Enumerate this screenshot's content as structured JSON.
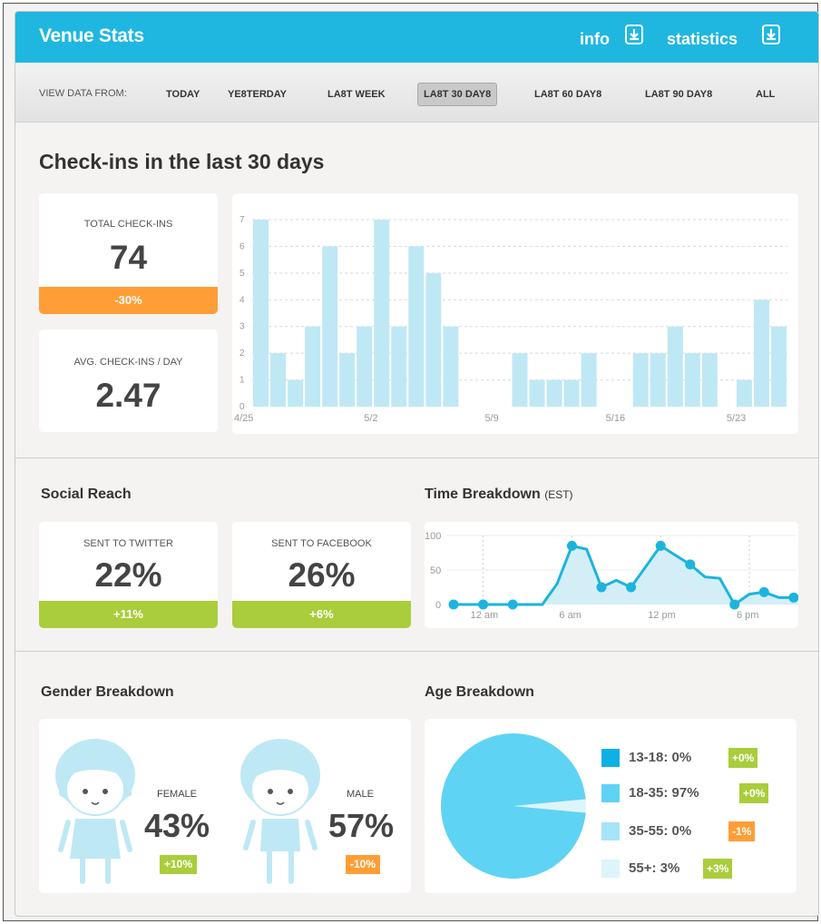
{
  "app": {
    "title": "Venue Stats",
    "info_label": "info",
    "statistics_label": "statistics"
  },
  "filter": {
    "label": "VIEW DATA FROM:",
    "options": [
      "TODAY",
      "YE8TERDAY",
      "LA8T WEEK",
      "LA8T 30 DAY8",
      "LA8T 60 DAY8",
      "LA8T 90 DAY8",
      "ALL"
    ],
    "selected": "LA8T 30 DAY8"
  },
  "checkins": {
    "heading": "Check-ins in the last 30 days",
    "total_label": "TOTAL CHECK-INS",
    "total_value": "74",
    "total_change": "-30%",
    "avg_label": "AVG. CHECK-INS / DAY",
    "avg_value": "2.47"
  },
  "social": {
    "heading": "Social Reach",
    "twitter_label": "SENT TO TWITTER",
    "twitter_value": "22%",
    "twitter_change": "+11%",
    "facebook_label": "SENT TO FACEBOOK",
    "facebook_value": "26%",
    "facebook_change": "+6%"
  },
  "time": {
    "heading": "Time Breakdown",
    "zone": "(EST)"
  },
  "gender": {
    "heading": "Gender Breakdown",
    "female_label": "FEMALE",
    "female_value": "43%",
    "female_change": "+10%",
    "male_label": "MALE",
    "male_value": "57%",
    "male_change": "-10%"
  },
  "age": {
    "heading": "Age Breakdown",
    "items": [
      {
        "label": "13-18: 0%",
        "change": "+0%"
      },
      {
        "label": "18-35: 97%",
        "change": "+0%"
      },
      {
        "label": "35-55: 0%",
        "change": "-1%"
      },
      {
        "label": "55+: 3%",
        "change": "+3%"
      }
    ]
  },
  "colors": {
    "header": "#1fb7e0",
    "bar": "#bfe8f5",
    "orange": "#ff9e37",
    "green": "#aacd3b",
    "line": "#1cb4dd"
  },
  "chart_data": [
    {
      "type": "bar",
      "title": "Check-ins in the last 30 days",
      "categories": [
        "4/25",
        "4/26",
        "4/27",
        "4/28",
        "4/29",
        "4/30",
        "5/1",
        "5/2",
        "5/3",
        "5/4",
        "5/5",
        "5/6",
        "5/7",
        "5/8",
        "5/9",
        "5/10",
        "5/11",
        "5/12",
        "5/13",
        "5/14",
        "5/15",
        "5/16",
        "5/17",
        "5/18",
        "5/19",
        "5/20",
        "5/21",
        "5/22",
        "5/23",
        "5/24"
      ],
      "values": [
        7,
        2,
        1,
        3,
        6,
        2,
        3,
        7,
        3,
        6,
        5,
        3,
        0,
        0,
        0,
        2,
        1,
        1,
        1,
        2,
        0,
        0,
        2,
        2,
        3,
        2,
        2,
        0,
        1,
        4,
        3
      ],
      "x_tick_labels": [
        "4/25",
        "5/2",
        "5/9",
        "5/16",
        "5/23"
      ],
      "y_ticks": [
        0,
        1,
        2,
        3,
        4,
        5,
        6,
        7
      ],
      "ylim": [
        0,
        7
      ],
      "grid": true
    },
    {
      "type": "area",
      "title": "Time Breakdown (EST)",
      "x_tick_labels": [
        "12 am",
        "6 am",
        "12 pm",
        "6 pm"
      ],
      "y_ticks": [
        0,
        50,
        100
      ],
      "ylim": [
        0,
        100
      ],
      "x": [
        -2,
        0,
        2,
        4,
        5,
        6,
        7,
        8,
        9,
        10,
        12,
        14,
        15,
        16,
        17,
        18,
        19,
        20,
        21,
        22,
        23
      ],
      "values": [
        0,
        0,
        0,
        0,
        30,
        85,
        80,
        25,
        35,
        25,
        85,
        58,
        40,
        38,
        0,
        15,
        18,
        10,
        10,
        10,
        5
      ],
      "markers": [
        true,
        true,
        true,
        false,
        false,
        true,
        false,
        true,
        false,
        true,
        true,
        true,
        false,
        false,
        true,
        false,
        true,
        false,
        true,
        false,
        true
      ],
      "grid": true
    },
    {
      "type": "pie",
      "title": "Age Breakdown",
      "labels": [
        "13-18",
        "18-35",
        "35-55",
        "55+"
      ],
      "values": [
        0,
        97,
        0,
        3
      ],
      "colors": [
        "#0fb1e4",
        "#5fd3f3",
        "#a6e4f7",
        "#ddf4fb"
      ]
    }
  ]
}
